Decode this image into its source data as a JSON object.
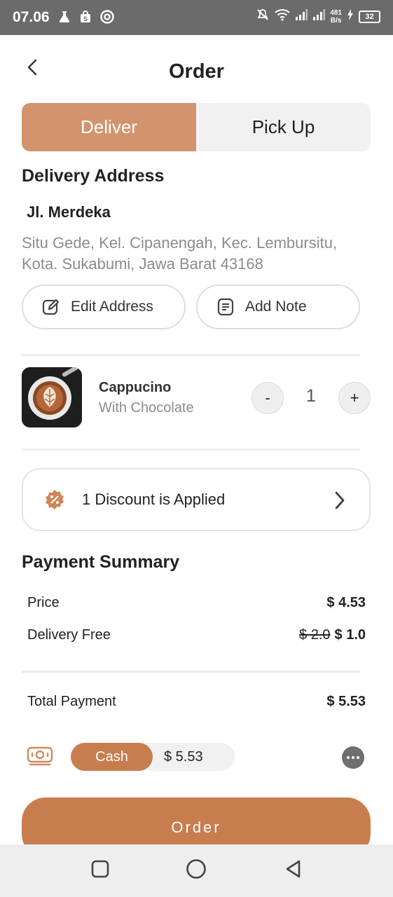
{
  "status_bar": {
    "time": "07.06",
    "net_speed_value": "481",
    "net_speed_unit": "B/s",
    "battery": "32"
  },
  "header": {
    "title": "Order"
  },
  "tabs": [
    {
      "label": "Deliver",
      "active": true
    },
    {
      "label": "Pick Up",
      "active": false
    }
  ],
  "address": {
    "section_title": "Delivery Address",
    "name": "Jl. Merdeka",
    "line1": "Situ Gede, Kel. Cipanengah, Kec. Lembursitu,",
    "line2": "Kota. Sukabumi, Jawa Barat 43168",
    "edit_label": "Edit Address",
    "note_label": "Add Note"
  },
  "item": {
    "name": "Cappucino",
    "variant": "With Chocolate",
    "quantity": "1",
    "minus_label": "-",
    "plus_label": "+"
  },
  "discount": {
    "label": "1 Discount is Applied"
  },
  "summary": {
    "title": "Payment Summary",
    "price_label": "Price",
    "price_value": "$ 4.53",
    "delivery_label": "Delivery Free",
    "delivery_old": "$ 2.0",
    "delivery_value": "$ 1.0",
    "total_label": "Total Payment",
    "total_value": "$ 5.53"
  },
  "payment": {
    "method": "Cash",
    "amount": "$ 5.53"
  },
  "order_button": {
    "label": "Order"
  },
  "colors": {
    "accent": "#c87d4f",
    "tab_active": "#d3936e",
    "muted_text": "#8c8c8c",
    "status_bar": "#6b6b6b"
  },
  "icons": [
    "back-icon",
    "edit-icon",
    "note-icon",
    "discount-icon",
    "chevron-right-icon",
    "cash-icon",
    "more-icon",
    "nav-recents-icon",
    "nav-home-icon",
    "nav-back-icon"
  ]
}
